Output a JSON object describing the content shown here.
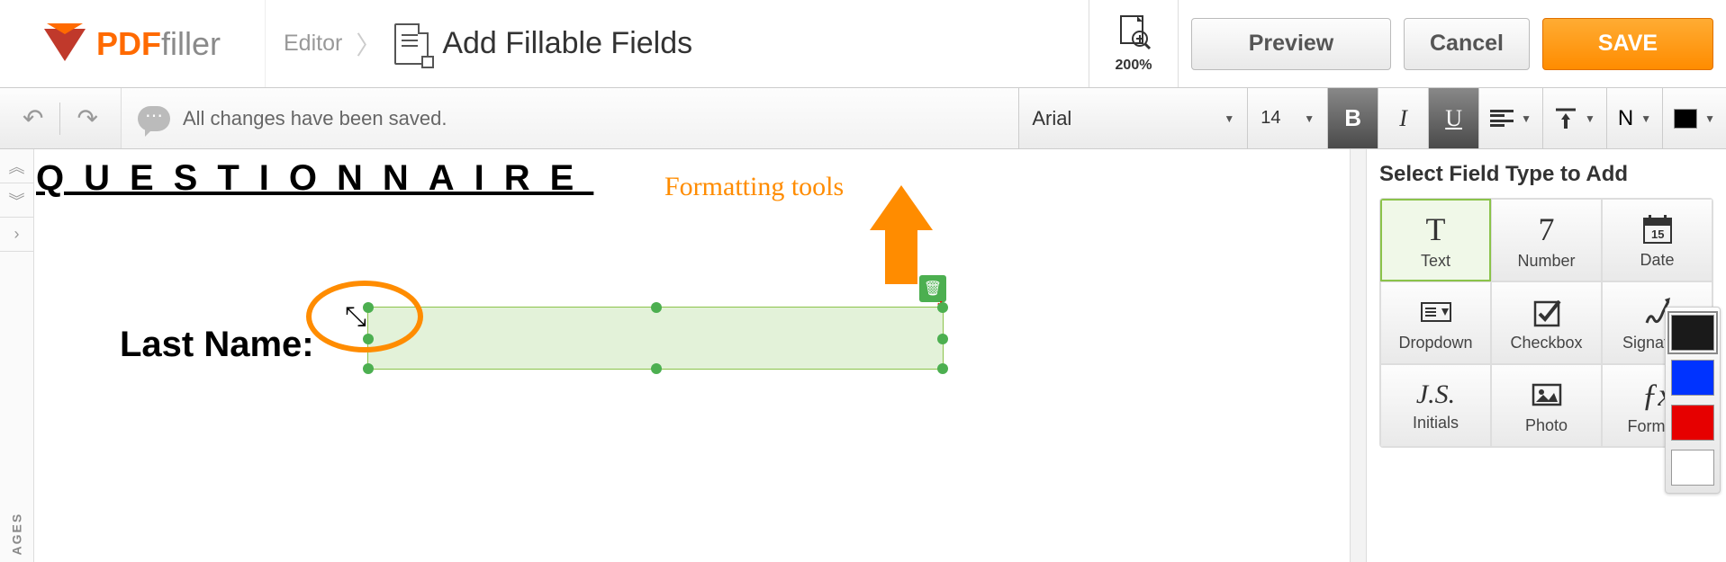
{
  "logo": {
    "brand": "PDF",
    "suffix": "filler"
  },
  "breadcrumb": {
    "step1": "Editor",
    "step2": "Add Fillable Fields"
  },
  "zoom": {
    "value": "200%"
  },
  "buttons": {
    "preview": "Preview",
    "cancel": "Cancel",
    "save": "SAVE"
  },
  "status": {
    "text": "All changes have been saved."
  },
  "format": {
    "font": "Arial",
    "size": "14",
    "n_label": "N"
  },
  "annotation": {
    "label": "Formatting tools"
  },
  "document": {
    "heading": "QUESTIONNAIRE",
    "field_label": "Last Name:"
  },
  "panel": {
    "title": "Select Field Type to Add"
  },
  "field_types": {
    "text": "Text",
    "number": "Number",
    "date": "Date",
    "dropdown": "Dropdown",
    "checkbox": "Checkbox",
    "signature": "Signature",
    "initials": "Initials",
    "photo": "Photo",
    "formula": "Formula"
  },
  "sidebar": {
    "pages": "AGES"
  },
  "colors": {
    "black": "#1a1a1a",
    "blue": "#0033ff",
    "red": "#e60000",
    "white": "#ffffff",
    "accent": "#ff8c00",
    "field": "#8bc34a"
  }
}
